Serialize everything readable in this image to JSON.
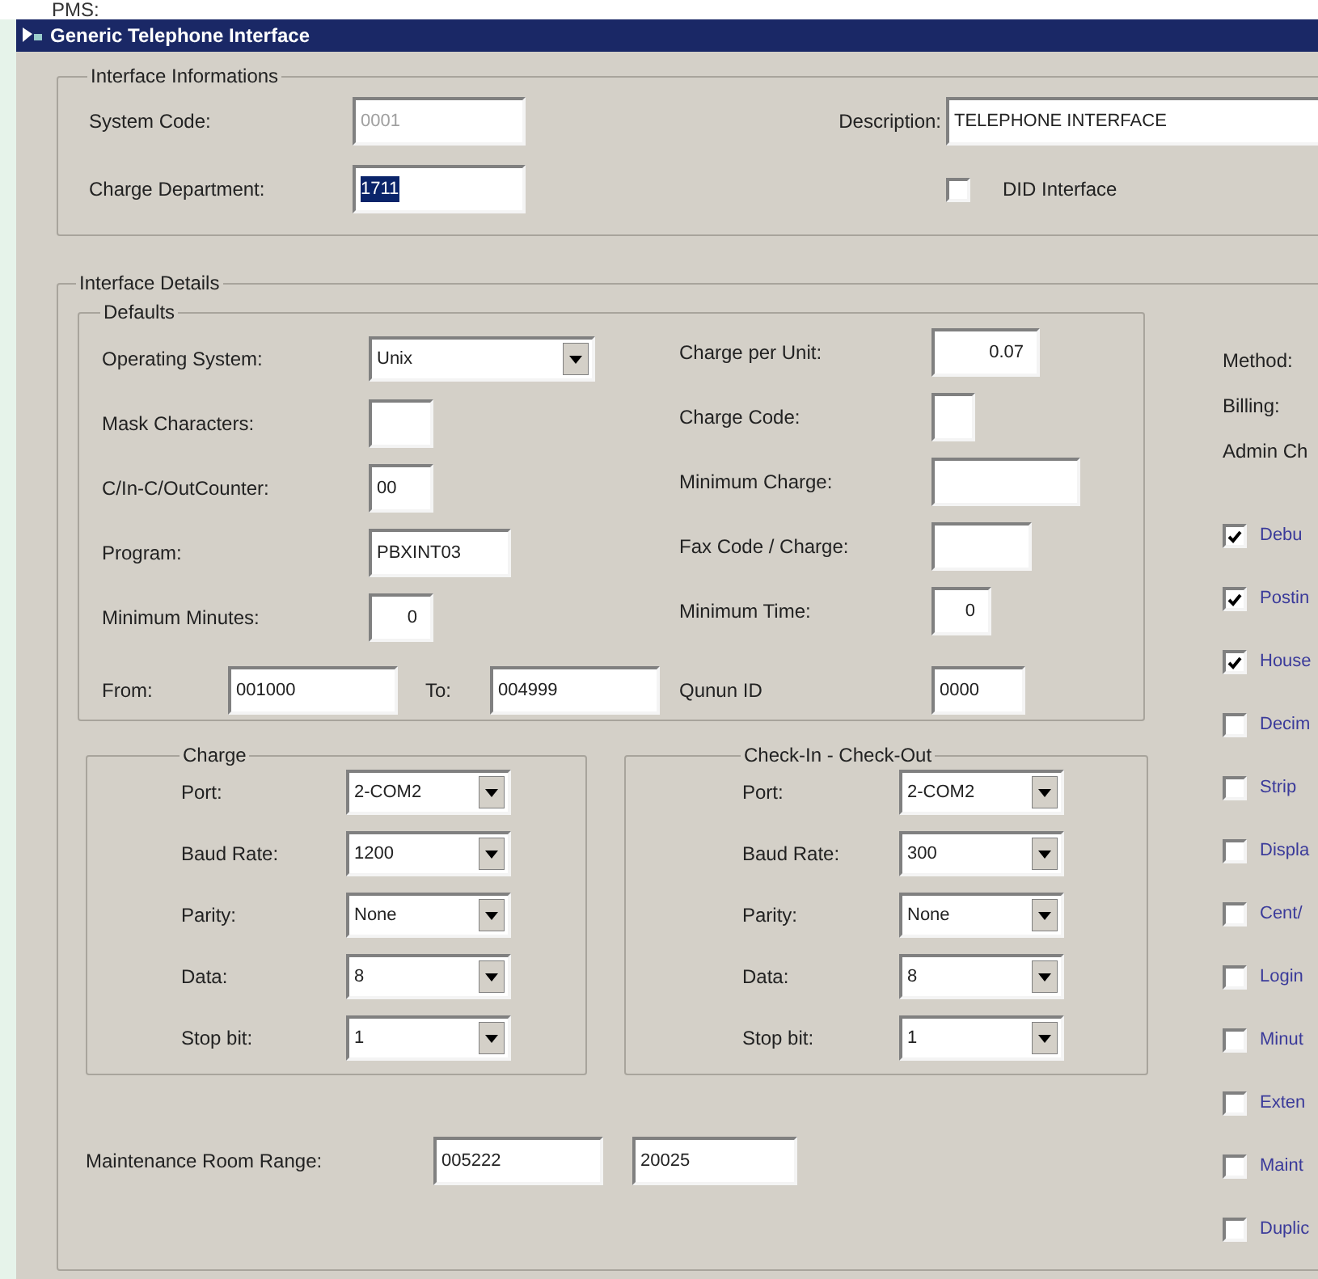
{
  "header_text": "PMS:",
  "window": {
    "title": "Generic Telephone Interface"
  },
  "interface_informations": {
    "title": "Interface Informations",
    "system_code": {
      "label": "System Code:",
      "value": "0001",
      "disabled": true
    },
    "charge_department": {
      "label": "Charge Department:",
      "value": "1711",
      "selected": true
    },
    "description": {
      "label": "Description:",
      "value": "TELEPHONE INTERFACE"
    },
    "did_interface": {
      "label": "DID Interface",
      "checked": false
    }
  },
  "interface_details": {
    "title": "Interface Details",
    "defaults": {
      "title": "Defaults",
      "left_fields": [
        {
          "label": "Operating System:",
          "value": "Unix",
          "kind": "select"
        },
        {
          "label": "Mask Characters:",
          "kind": "text"
        },
        {
          "label": "C/In-C/OutCounter:",
          "value": "00",
          "kind": "text"
        },
        {
          "label": "Program:",
          "value": "PBXINT03",
          "kind": "text"
        },
        {
          "label": "Minimum Minutes:",
          "value": "0",
          "kind": "number"
        }
      ],
      "right_fields": [
        {
          "label": "Charge per Unit:",
          "value": "0.07",
          "kind": "number"
        },
        {
          "label": "Charge Code:",
          "kind": "text"
        },
        {
          "label": "Minimum Charge:",
          "kind": "text"
        },
        {
          "label": "Fax Code / Charge:",
          "kind": "text"
        },
        {
          "label": "Minimum Time:",
          "value": "0",
          "kind": "number"
        }
      ],
      "from": {
        "label": "From:",
        "value": "001000"
      },
      "to": {
        "label": "To:",
        "value": "004999"
      },
      "queue_id": {
        "label": "Qunun ID",
        "value": "0000"
      }
    },
    "port_groups": [
      {
        "title": "Charge",
        "fields": [
          {
            "label": "Port:",
            "value": "2-COM2"
          },
          {
            "label": "Baud Rate:",
            "value": "1200"
          },
          {
            "label": "Parity:",
            "value": "None"
          },
          {
            "label": "Data:",
            "value": "8"
          },
          {
            "label": "Stop bit:",
            "value": "1"
          }
        ]
      },
      {
        "title": "Check-In - Check-Out",
        "fields": [
          {
            "label": "Port:",
            "value": "2-COM2"
          },
          {
            "label": "Baud Rate:",
            "value": "300"
          },
          {
            "label": "Parity:",
            "value": "None"
          },
          {
            "label": "Data:",
            "value": "8"
          },
          {
            "label": "Stop bit:",
            "value": "1"
          }
        ]
      }
    ],
    "maintenance_room_range": {
      "label": "Maintenance Room Range:",
      "from": "005222",
      "to": "20025"
    },
    "options": [
      {
        "kind": "label",
        "label": "Method:"
      },
      {
        "kind": "label",
        "label": "Billing:"
      },
      {
        "kind": "label",
        "label": "Admin Ch"
      },
      {
        "kind": "checkbox",
        "label": "Debu",
        "checked": true
      },
      {
        "kind": "checkbox",
        "label": "Postin",
        "checked": true
      },
      {
        "kind": "checkbox",
        "label": "House",
        "checked": true
      },
      {
        "kind": "checkbox",
        "label": "Decim",
        "checked": false
      },
      {
        "kind": "checkbox",
        "label": "Strip",
        "checked": false
      },
      {
        "kind": "checkbox",
        "label": "Displa",
        "checked": false
      },
      {
        "kind": "checkbox",
        "label": "Cent/",
        "checked": false
      },
      {
        "kind": "checkbox",
        "label": "Login",
        "checked": false
      },
      {
        "kind": "checkbox",
        "label": "Minut",
        "checked": false
      },
      {
        "kind": "checkbox",
        "label": "Exten",
        "checked": false
      },
      {
        "kind": "checkbox",
        "label": "Maint",
        "checked": false
      },
      {
        "kind": "checkbox",
        "label": "Duplic",
        "checked": false
      }
    ]
  }
}
